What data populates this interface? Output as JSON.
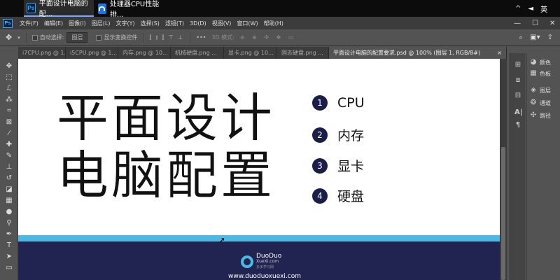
{
  "taskbar": {
    "tasks": [
      {
        "icon": "Ps",
        "label": "平面设计电脑的配..."
      },
      {
        "label": "处理器CPU性能排..."
      }
    ],
    "tray": {
      "chevron": "^",
      "volume": "◄",
      "ime": "英"
    }
  },
  "menubar": {
    "items": [
      "文件(F)",
      "编辑(E)",
      "图像(I)",
      "图层(L)",
      "文字(Y)",
      "选择(S)",
      "滤镜(T)",
      "3D(D)",
      "视图(V)",
      "窗口(W)",
      "帮助(H)"
    ],
    "window_controls": {
      "minimize": "—",
      "maximize": "☐",
      "close": "✕"
    }
  },
  "options": {
    "auto_select_label": "自动选择:",
    "auto_select_value": "图层",
    "transform_label": "显示变换控件",
    "more": "•••",
    "mode_3d": "3D 模式:"
  },
  "tabs": [
    {
      "label": "i7CPU.png @ 1..."
    },
    {
      "label": "i5CPU.png @ 1..."
    },
    {
      "label": "内存.png @ 10..."
    },
    {
      "label": "机械硬盘.png ..."
    },
    {
      "label": "显卡.png @ 10..."
    },
    {
      "label": "固态硬盘.png ..."
    },
    {
      "label": "平面设计电脑的配置要求.psd @ 100% (图层 1, RGB/8#)",
      "close": "×"
    }
  ],
  "canvas": {
    "title_line1": "平面设计",
    "title_line2": "电脑配置",
    "items": [
      {
        "num": "1",
        "label": "CPU"
      },
      {
        "num": "2",
        "label": "内存"
      },
      {
        "num": "3",
        "label": "显卡"
      },
      {
        "num": "4",
        "label": "硬盘"
      }
    ],
    "footer": {
      "logo_name": "DuoDuo",
      "logo_sub": "XueXi.com",
      "logo_tag": "多多学习网",
      "url": "www.duoduoxuexi.com"
    }
  },
  "panels": {
    "items": [
      {
        "icon": "palette-icon",
        "label": "颜色"
      },
      {
        "icon": "swatches-icon",
        "label": "色板"
      },
      {
        "icon": "layers-icon",
        "label": "图层"
      },
      {
        "icon": "channels-icon",
        "label": "通道"
      },
      {
        "icon": "paths-icon",
        "label": "路径"
      }
    ]
  },
  "colors": {
    "accent_stripe": "#4db8e3",
    "footer_bg": "#212450",
    "number_circle": "#1a1d4a"
  }
}
